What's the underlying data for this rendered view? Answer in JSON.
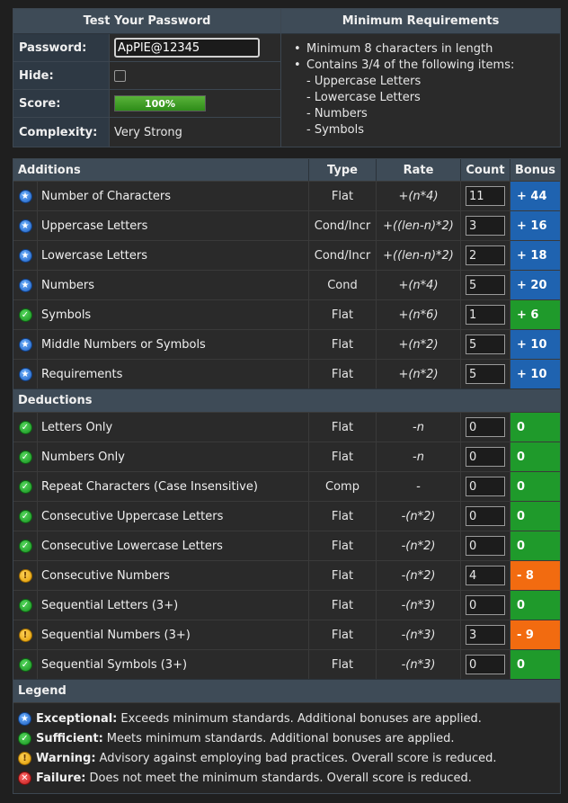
{
  "test": {
    "title": "Test Your Password",
    "password_label": "Password:",
    "password_value": "ApPlE@12345",
    "hide_label": "Hide:",
    "score_label": "Score:",
    "score_text": "100%",
    "score_fraction": 1.0,
    "complexity_label": "Complexity:",
    "complexity_value": "Very Strong"
  },
  "requirements": {
    "title": "Minimum Requirements",
    "items": [
      "Minimum 8 characters in length",
      "Contains 3/4 of the following items:"
    ],
    "sub_items": [
      "- Uppercase Letters",
      "- Lowercase Letters",
      "- Numbers",
      "- Symbols"
    ]
  },
  "table": {
    "headers": {
      "name": "Additions",
      "type": "Type",
      "rate": "Rate",
      "count": "Count",
      "bonus": "Bonus"
    },
    "deductions_title": "Deductions",
    "legend_title": "Legend"
  },
  "additions": [
    {
      "icon": "exceptional-icon",
      "name": "Number of Characters",
      "type": "Flat",
      "rate": "+(n*4)",
      "count": "11",
      "bonus": "+ 44",
      "bonus_color": "blue"
    },
    {
      "icon": "exceptional-icon",
      "name": "Uppercase Letters",
      "type": "Cond/Incr",
      "rate": "+((len-n)*2)",
      "count": "3",
      "bonus": "+ 16",
      "bonus_color": "blue"
    },
    {
      "icon": "exceptional-icon",
      "name": "Lowercase Letters",
      "type": "Cond/Incr",
      "rate": "+((len-n)*2)",
      "count": "2",
      "bonus": "+ 18",
      "bonus_color": "blue"
    },
    {
      "icon": "exceptional-icon",
      "name": "Numbers",
      "type": "Cond",
      "rate": "+(n*4)",
      "count": "5",
      "bonus": "+ 20",
      "bonus_color": "blue"
    },
    {
      "icon": "sufficient-icon",
      "name": "Symbols",
      "type": "Flat",
      "rate": "+(n*6)",
      "count": "1",
      "bonus": "+ 6",
      "bonus_color": "green"
    },
    {
      "icon": "exceptional-icon",
      "name": "Middle Numbers or Symbols",
      "type": "Flat",
      "rate": "+(n*2)",
      "count": "5",
      "bonus": "+ 10",
      "bonus_color": "blue"
    },
    {
      "icon": "exceptional-icon",
      "name": "Requirements",
      "type": "Flat",
      "rate": "+(n*2)",
      "count": "5",
      "bonus": "+ 10",
      "bonus_color": "blue"
    }
  ],
  "deductions": [
    {
      "icon": "sufficient-icon",
      "name": "Letters Only",
      "type": "Flat",
      "rate": "-n",
      "count": "0",
      "bonus": "0",
      "bonus_color": "green"
    },
    {
      "icon": "sufficient-icon",
      "name": "Numbers Only",
      "type": "Flat",
      "rate": "-n",
      "count": "0",
      "bonus": "0",
      "bonus_color": "green"
    },
    {
      "icon": "sufficient-icon",
      "name": "Repeat Characters (Case Insensitive)",
      "type": "Comp",
      "rate": "-",
      "count": "0",
      "bonus": "0",
      "bonus_color": "green"
    },
    {
      "icon": "sufficient-icon",
      "name": "Consecutive Uppercase Letters",
      "type": "Flat",
      "rate": "-(n*2)",
      "count": "0",
      "bonus": "0",
      "bonus_color": "green"
    },
    {
      "icon": "sufficient-icon",
      "name": "Consecutive Lowercase Letters",
      "type": "Flat",
      "rate": "-(n*2)",
      "count": "0",
      "bonus": "0",
      "bonus_color": "green"
    },
    {
      "icon": "warning-icon",
      "name": "Consecutive Numbers",
      "type": "Flat",
      "rate": "-(n*2)",
      "count": "4",
      "bonus": "- 8",
      "bonus_color": "orange"
    },
    {
      "icon": "sufficient-icon",
      "name": "Sequential Letters (3+)",
      "type": "Flat",
      "rate": "-(n*3)",
      "count": "0",
      "bonus": "0",
      "bonus_color": "green"
    },
    {
      "icon": "warning-icon",
      "name": "Sequential Numbers (3+)",
      "type": "Flat",
      "rate": "-(n*3)",
      "count": "3",
      "bonus": "- 9",
      "bonus_color": "orange"
    },
    {
      "icon": "sufficient-icon",
      "name": "Sequential Symbols (3+)",
      "type": "Flat",
      "rate": "-(n*3)",
      "count": "0",
      "bonus": "0",
      "bonus_color": "green"
    }
  ],
  "legend": [
    {
      "icon": "exceptional-icon",
      "term": "Exceptional:",
      "text": "Exceeds minimum standards. Additional bonuses are applied."
    },
    {
      "icon": "sufficient-icon",
      "term": "Sufficient:",
      "text": "Meets minimum standards. Additional bonuses are applied."
    },
    {
      "icon": "warning-icon",
      "term": "Warning:",
      "text": "Advisory against employing bad practices. Overall score is reduced."
    },
    {
      "icon": "failure-icon",
      "term": "Failure:",
      "text": "Does not meet the minimum standards. Overall score is reduced."
    }
  ],
  "colors": {
    "blue": "#1f63b0",
    "green": "#1f9a2b",
    "orange": "#f26b10",
    "header": "#3e4b57"
  }
}
